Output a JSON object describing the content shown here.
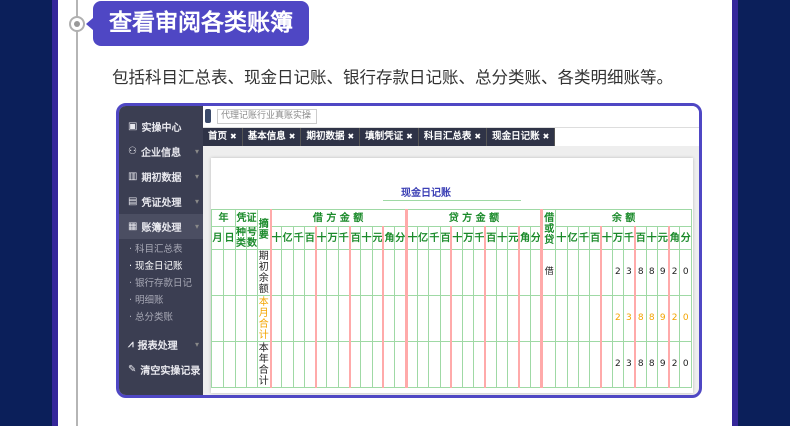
{
  "heading": "查看审阅各类账簿",
  "description": "包括科目汇总表、现金日记账、银行存款日记账、总分类账、各类明细账等。",
  "sidebar": {
    "items": [
      {
        "label": "实操中心",
        "icon": "monitor-icon"
      },
      {
        "label": "企业信息",
        "icon": "users-icon"
      },
      {
        "label": "期初数据",
        "icon": "bar-chart-icon"
      },
      {
        "label": "凭证处理",
        "icon": "document-icon"
      },
      {
        "label": "账簿处理",
        "icon": "book-icon"
      }
    ],
    "sub_items": [
      "科目汇总表",
      "现金日记账",
      "银行存款日记",
      "明细账",
      "总分类账"
    ],
    "bottom_items": [
      {
        "label": "报表处理",
        "icon": "line-chart-icon"
      },
      {
        "label": "清空实操记录",
        "icon": "broom-icon"
      }
    ]
  },
  "search": {
    "placeholder": "代理记账行业真账实操"
  },
  "tabs": [
    "首页",
    "基本信息",
    "期初数据",
    "填制凭证",
    "科目汇总表",
    "现金日记账"
  ],
  "ledger": {
    "title": "现金日记账",
    "h_year": "年",
    "h_month": "月",
    "h_day": "日",
    "h_voucher": "凭证",
    "h_type": "种类",
    "h_no": "号数",
    "h_summary": "摘要",
    "h_debit": "借 方 金 额",
    "h_credit": "贷 方 金 额",
    "h_dc": "借或贷",
    "h_balance": "余 额",
    "units": [
      "十",
      "亿",
      "千",
      "百",
      "十",
      "万",
      "千",
      "百",
      "十",
      "元",
      "角",
      "分"
    ],
    "rows": [
      {
        "summary": "期初余额",
        "dc": "借",
        "balance_digits": [
          "2",
          "3",
          "8",
          "8",
          "9",
          "2",
          "0"
        ]
      },
      {
        "summary": "本月合计",
        "dc": "",
        "balance_digits": [
          "2",
          "3",
          "8",
          "8",
          "9",
          "2",
          "0"
        ]
      },
      {
        "summary": "本年合计",
        "dc": "",
        "balance_digits": [
          "2",
          "3",
          "8",
          "8",
          "9",
          "2",
          "0"
        ]
      }
    ]
  }
}
